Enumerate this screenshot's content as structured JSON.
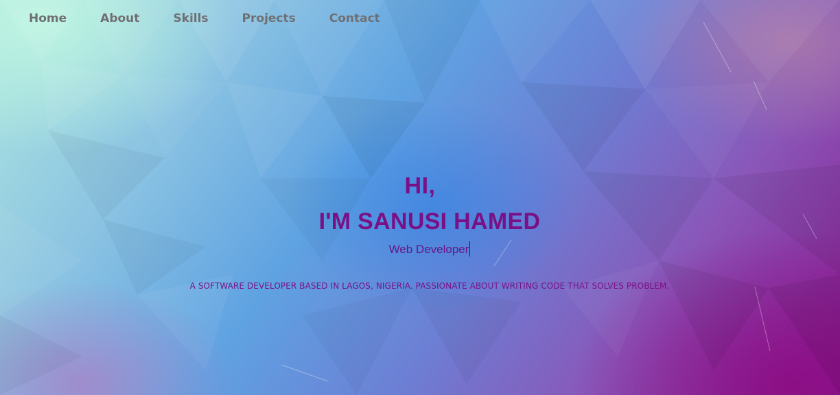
{
  "nav": {
    "items": [
      {
        "label": "Home"
      },
      {
        "label": "About"
      },
      {
        "label": "Skills"
      },
      {
        "label": "Projects"
      },
      {
        "label": "Contact"
      }
    ]
  },
  "hero": {
    "greeting": "HI,",
    "name": "I'M SANUSI HAMED",
    "role": "Web Developer",
    "tagline": "A SOFTWARE DEVELOPER BASED IN LAGOS, NIGERIA. PASSIONATE ABOUT WRITING CODE THAT SOLVES PROBLEM."
  },
  "colors": {
    "nav_text": "#6f6f72",
    "hero_text": "#7a0f86",
    "background_start": "#aee6e0",
    "background_mid": "#5fa2e2",
    "background_end": "#8a1a90"
  }
}
